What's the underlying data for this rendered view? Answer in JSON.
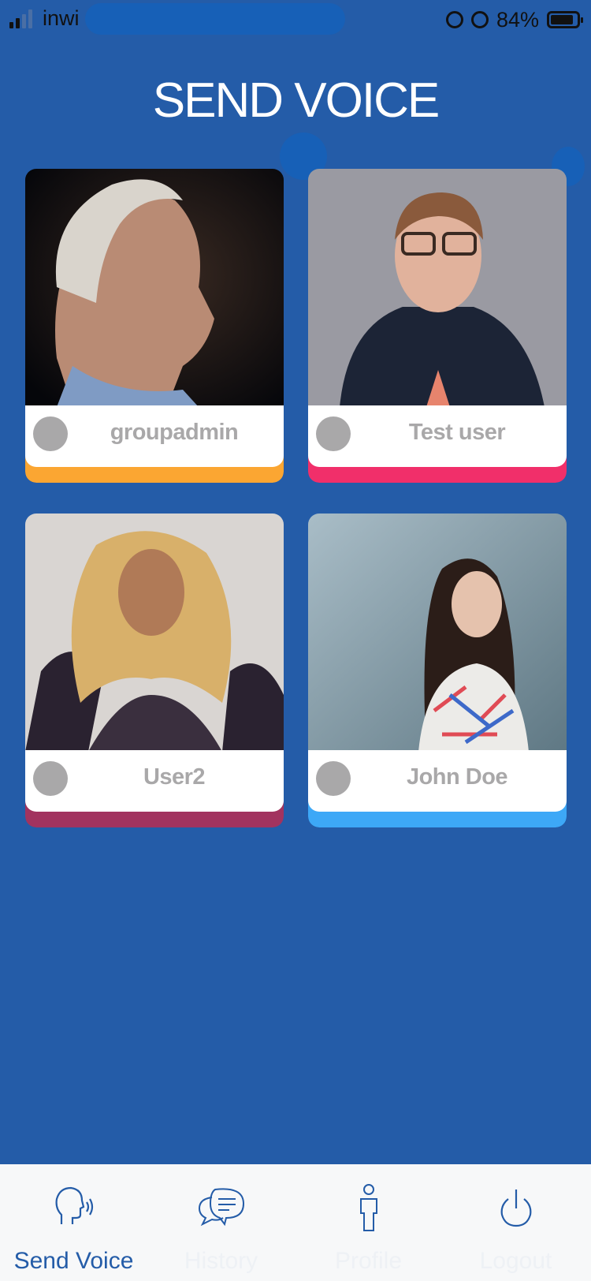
{
  "status_bar": {
    "carrier": "inwi",
    "battery_percent": "84%",
    "battery_level": 0.84
  },
  "title": "SEND VOICE",
  "users": [
    {
      "name": "groupadmin",
      "accent_color": "#FBA632"
    },
    {
      "name": "Test user",
      "accent_color": "#F12F6A"
    },
    {
      "name": "User2",
      "accent_color": "#A2335F"
    },
    {
      "name": "John Doe",
      "accent_color": "#3DA8F7"
    }
  ],
  "tabs": [
    {
      "label": "Send Voice",
      "icon": "speaking-head-icon",
      "active": true
    },
    {
      "label": "History",
      "icon": "chat-bubbles-icon",
      "active": false
    },
    {
      "label": "Profile",
      "icon": "person-icon",
      "active": false
    },
    {
      "label": "Logout",
      "icon": "power-icon",
      "active": false
    }
  ],
  "colors": {
    "background": "#245CA8",
    "tab_active": "#245CA8",
    "tab_bar": "#F7F8F9"
  }
}
